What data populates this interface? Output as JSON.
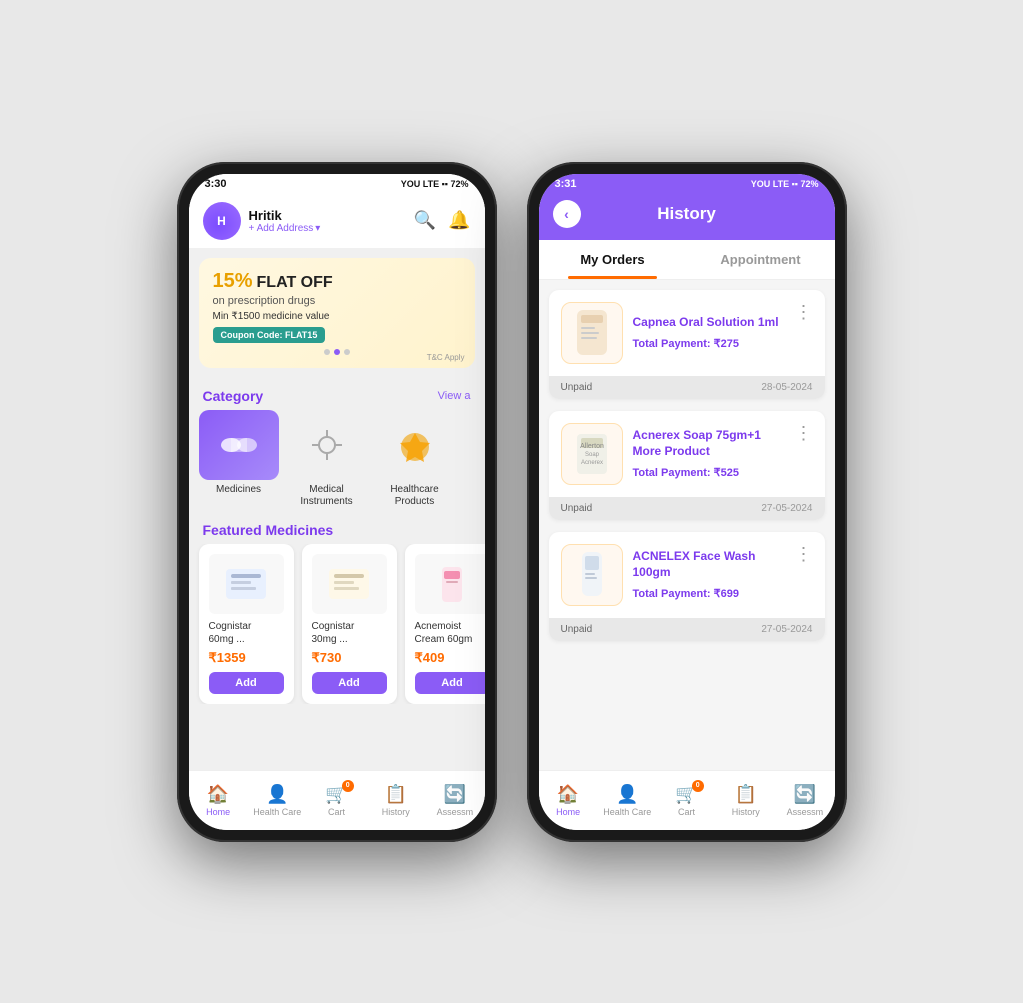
{
  "left_phone": {
    "status_bar": {
      "time": "3:30",
      "icons": "LTE • • 72%"
    },
    "header": {
      "username": "Hritik",
      "address_label": "+ Add Address",
      "search_icon": "🔍",
      "bell_icon": "🔔"
    },
    "banner": {
      "percent": "15%",
      "flat_off": "FLAT OFF",
      "subtitle": "on prescription drugs",
      "min_value": "Min ₹1500 medicine value",
      "coupon": "Coupon Code: FLAT15",
      "tc": "T&C Apply"
    },
    "category_section": {
      "title": "Category",
      "view_all": "View a",
      "items": [
        {
          "label": "Medicines"
        },
        {
          "label": "Medical\nInstruments"
        },
        {
          "label": "Healthcare\nProducts"
        }
      ]
    },
    "featured_section": {
      "title": "Featured Medicines",
      "products": [
        {
          "name": "Cognistar 60mg ...",
          "price": "₹1359",
          "add_label": "Add"
        },
        {
          "name": "Cognistar 30mg ...",
          "price": "₹730",
          "add_label": "Add"
        },
        {
          "name": "Acnemoist Cream 60gm",
          "price": "₹409",
          "add_label": "Add"
        }
      ]
    },
    "bottom_nav": {
      "items": [
        {
          "label": "Home",
          "icon": "🏠",
          "active": true
        },
        {
          "label": "Health Care",
          "icon": "👤",
          "active": false
        },
        {
          "label": "Cart",
          "icon": "🛒",
          "active": false,
          "badge": "0"
        },
        {
          "label": "History",
          "icon": "📋",
          "active": false
        },
        {
          "label": "Assessm",
          "icon": "🔄",
          "active": false
        }
      ]
    }
  },
  "right_phone": {
    "status_bar": {
      "time": "3:31",
      "icons": "LTE • • 72%"
    },
    "header": {
      "back_icon": "‹",
      "title": "History"
    },
    "tabs": [
      {
        "label": "My Orders",
        "active": true
      },
      {
        "label": "Appointment",
        "active": false
      }
    ],
    "orders": [
      {
        "name": "Capnea Oral Solution 1ml",
        "payment_label": "Total Payment: ",
        "payment_value": "₹275",
        "status": "Unpaid",
        "date": "28-05-2024"
      },
      {
        "name": "Acnerex Soap 75gm+1 More Product",
        "payment_label": "Total Payment: ",
        "payment_value": "₹525",
        "status": "Unpaid",
        "date": "27-05-2024"
      },
      {
        "name": "ACNELEX Face Wash 100gm",
        "payment_label": "Total Payment: ",
        "payment_value": "₹699",
        "status": "Unpaid",
        "date": "27-05-2024"
      }
    ],
    "bottom_nav": {
      "items": [
        {
          "label": "Home",
          "icon": "🏠",
          "active": true
        },
        {
          "label": "Health Care",
          "icon": "👤",
          "active": false
        },
        {
          "label": "Cart",
          "icon": "🛒",
          "active": false,
          "badge": "0"
        },
        {
          "label": "History",
          "icon": "📋",
          "active": false
        },
        {
          "label": "Assessm",
          "icon": "🔄",
          "active": false
        }
      ]
    }
  }
}
